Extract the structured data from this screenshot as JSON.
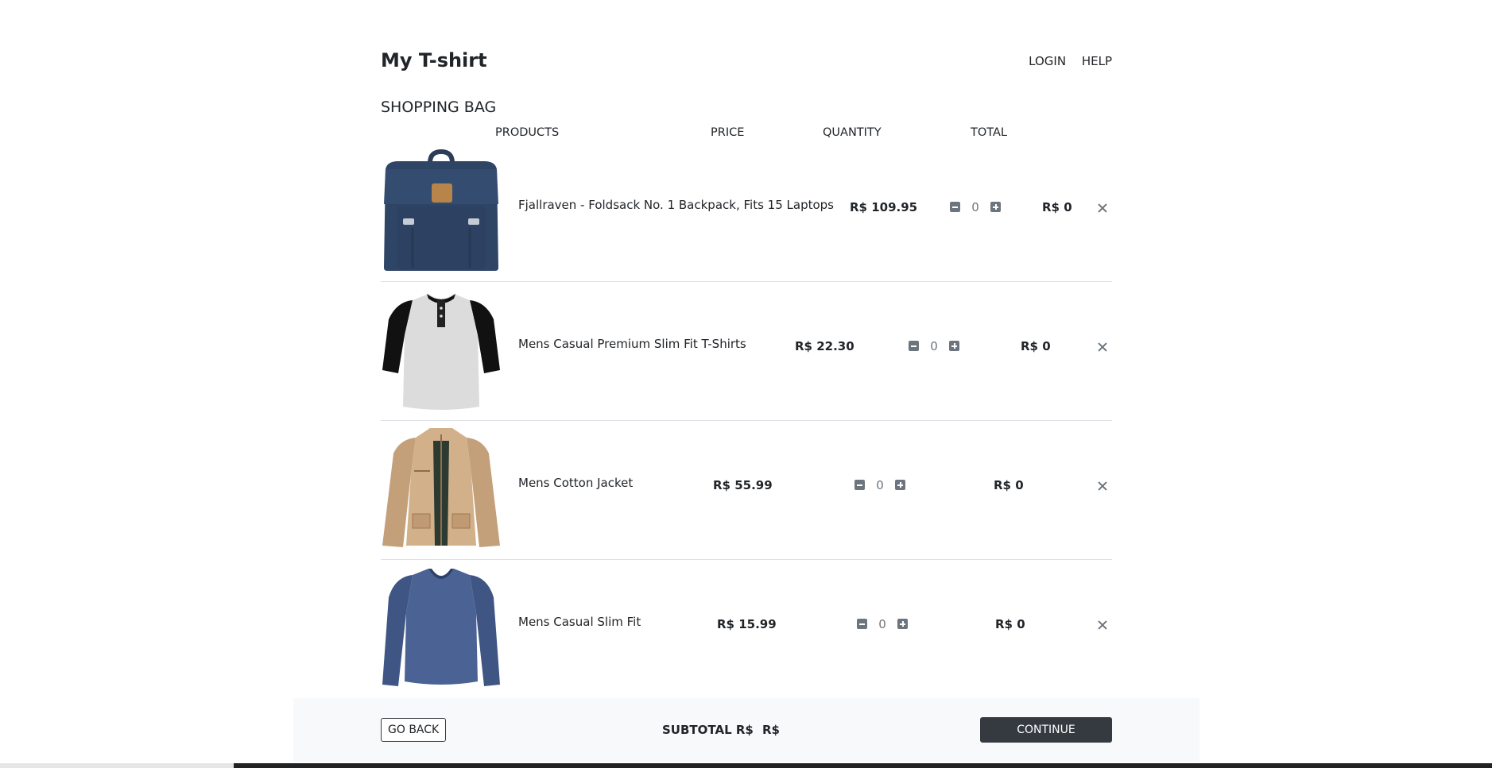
{
  "header": {
    "brand": "My T-shirt",
    "login": "LOGIN",
    "help": "HELP"
  },
  "bag_title": "SHOPPING BAG",
  "columns": {
    "products": "PRODUCTS",
    "price": "PRICE",
    "quantity": "QUANTITY",
    "total": "TOTAL"
  },
  "items": [
    {
      "name": "Fjallraven - Foldsack No. 1 Backpack, Fits 15 Laptops",
      "price": "R$ 109.95",
      "quantity": "0",
      "total": "R$ 0",
      "image": "backpack"
    },
    {
      "name": "Mens Casual Premium Slim Fit T-Shirts",
      "price": "R$ 22.30",
      "quantity": "0",
      "total": "R$ 0",
      "image": "raglan-shirt"
    },
    {
      "name": "Mens Cotton Jacket",
      "price": "R$ 55.99",
      "quantity": "0",
      "total": "R$ 0",
      "image": "jacket"
    },
    {
      "name": "Mens Casual Slim Fit",
      "price": "R$ 15.99",
      "quantity": "0",
      "total": "R$ 0",
      "image": "long-sleeve-shirt"
    }
  ],
  "footer": {
    "go_back": "GO BACK",
    "subtotal_label": "SUBTOTAL R$",
    "subtotal_value": "R$",
    "continue": "CONTINUE"
  },
  "colors": {
    "dark": "#343a40",
    "muted": "#6c757d",
    "footer_bg": "#f8f9fa"
  }
}
